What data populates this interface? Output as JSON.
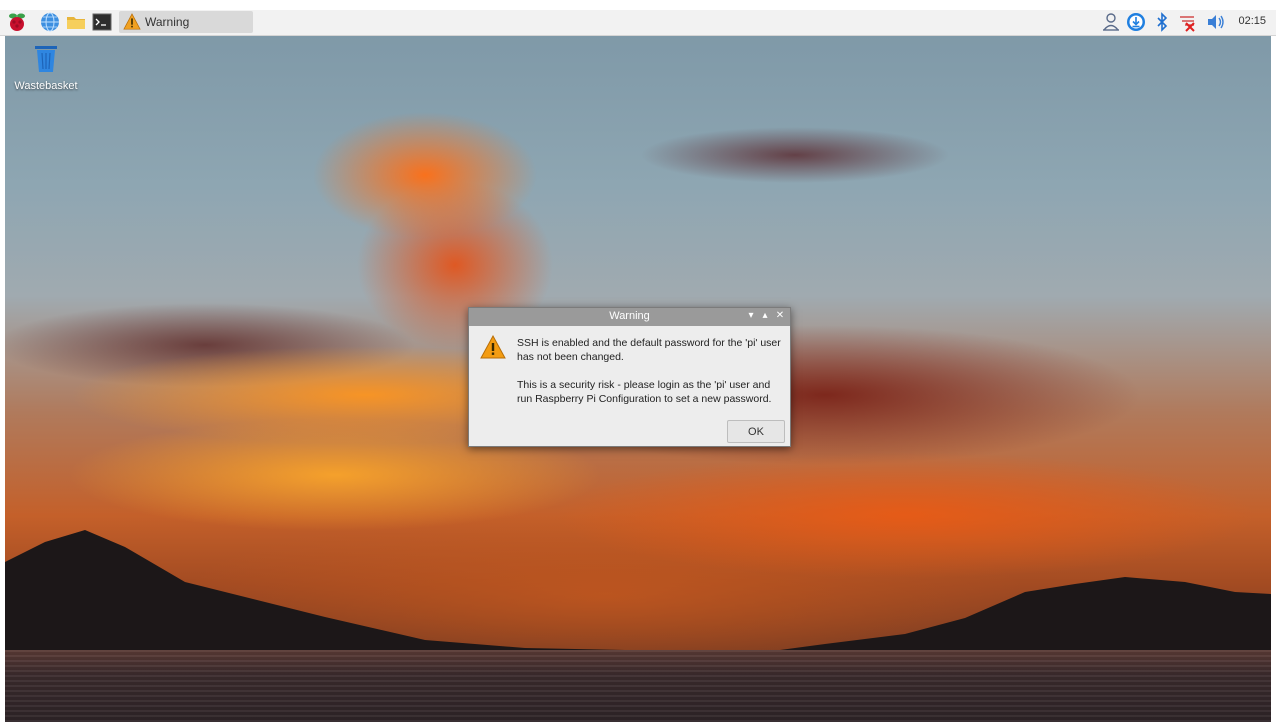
{
  "taskbar": {
    "icons": {
      "menu": "raspberry-menu-icon",
      "browser": "web-browser-icon",
      "files": "file-manager-icon",
      "terminal": "terminal-icon"
    },
    "task_window_label": "Warning",
    "tray": {
      "icons": [
        "user-icon",
        "update-download-icon",
        "bluetooth-icon",
        "network-disconnected-icon",
        "volume-icon"
      ],
      "clock": "02:15"
    }
  },
  "desktop": {
    "icons": [
      {
        "label": "Wastebasket",
        "icon": "trash-icon"
      }
    ]
  },
  "dialog": {
    "title": "Warning",
    "message_line1": "SSH is enabled and the default password for the 'pi' user",
    "message_line2": "has not been changed.",
    "message_line3": "This is a security risk - please login as the 'pi' user and",
    "message_line4": "run Raspberry Pi Configuration to set a new password.",
    "ok_label": "OK"
  },
  "colors": {
    "taskbar_bg": "#f2f2f2",
    "dialog_titlebar": "#9a9a9a",
    "dialog_bg": "#ededed",
    "warning_accent": "#f39c12"
  }
}
